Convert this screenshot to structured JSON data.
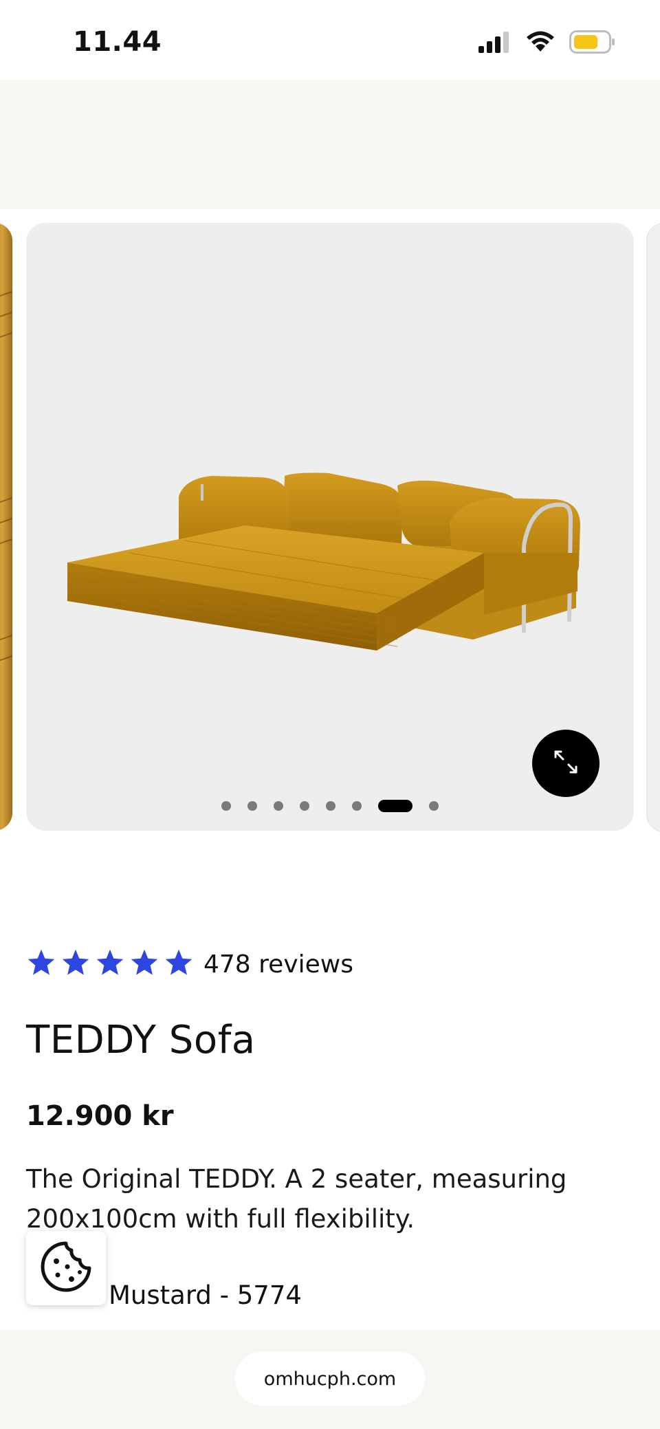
{
  "status_bar": {
    "time": "11.44",
    "icons": [
      "signal-icon",
      "wifi-icon",
      "battery-icon"
    ],
    "battery_color": "#f5c518"
  },
  "gallery": {
    "image_alt": "TEDDY Sofa in mustard corduroy, unfolded",
    "slide_count": 8,
    "active_slide": 7,
    "expand_icon": "expand-arrows-icon",
    "card_background": "#eeeeee"
  },
  "product": {
    "rating_stars": 5,
    "star_color": "#2f45e0",
    "reviews": "478 reviews",
    "title": "TEDDY Sofa",
    "price": "12.900 kr",
    "description": "The Original TEDDY. A 2 seater, measuring 200x100cm with full flexibility.",
    "color_visible": "Mustard - 5774"
  },
  "cookie": {
    "icon": "cookie-icon"
  },
  "browser": {
    "url": "omhucph.com"
  }
}
